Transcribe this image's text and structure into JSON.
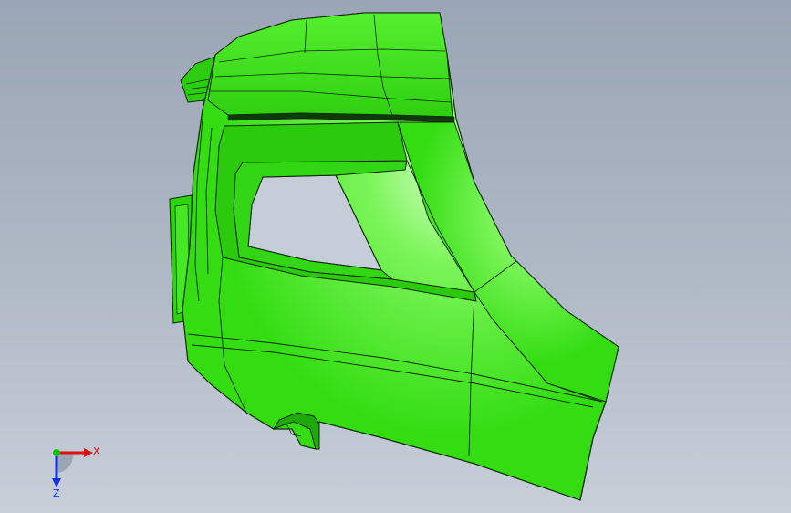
{
  "viewport": {
    "background_top": "#9aa5b5",
    "background_bottom": "#c8cfd9"
  },
  "model": {
    "body_color": "#3ee61c",
    "highlight_color": "#c8ffb4",
    "edge_color": "#0a2a05"
  },
  "triad": {
    "x_label": "X",
    "z_label": "Z",
    "x_color": "#e01010",
    "y_color": "#10c010",
    "z_color": "#1030e0"
  }
}
